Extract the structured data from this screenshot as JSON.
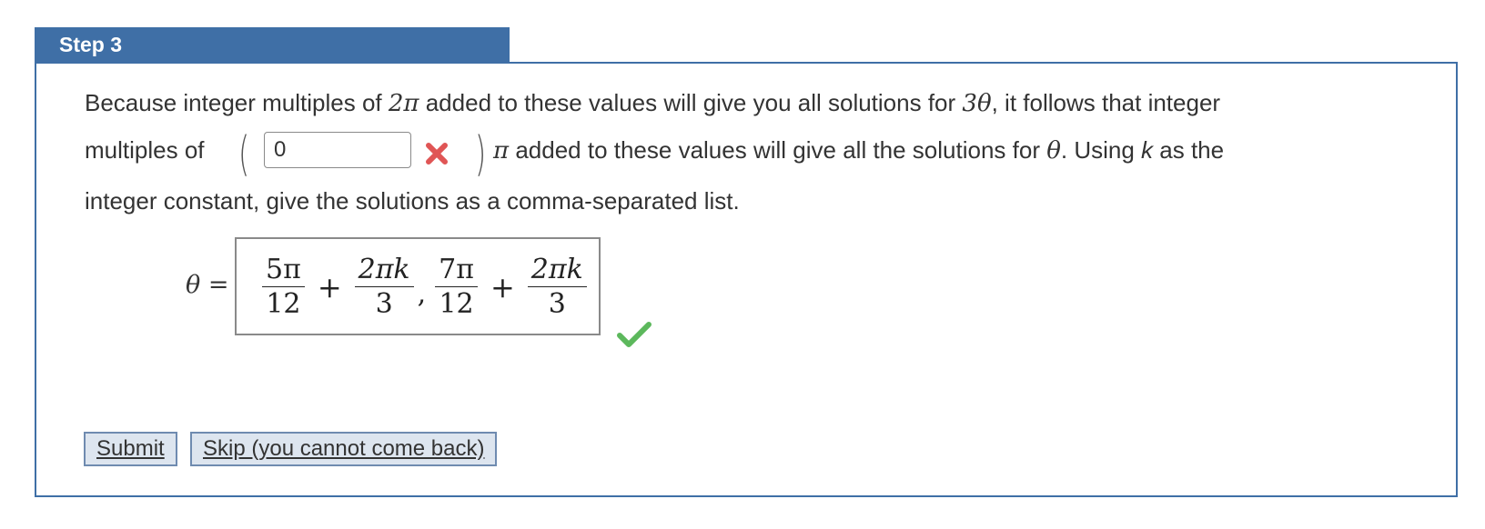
{
  "step": {
    "title": "Step 3"
  },
  "paragraph": {
    "line1_a": "Because integer multiples of ",
    "line1_2pi": "2π",
    "line1_b": " added to these values will give you all solutions for ",
    "line1_3theta": "3θ",
    "line1_c": ", it follows that integer",
    "line2_a": "multiples of",
    "line2_pi": "π",
    "line2_b": " added to these values will give all the solutions for ",
    "line2_theta": "θ",
    "line2_c": ". Using ",
    "line2_k": "k",
    "line2_d": " as the",
    "line3": "integer constant, give the solutions as a comma-separated list."
  },
  "multiple_input": {
    "value": "0",
    "status": "incorrect"
  },
  "solution": {
    "lhs": "θ =",
    "term1_num": "5π",
    "term1_den": "12",
    "plus1": "+",
    "term2_num": "2πk",
    "term2_den": "3",
    "comma": ",",
    "term3_num": "7π",
    "term3_den": "12",
    "plus2": "+",
    "term4_num": "2πk",
    "term4_den": "3",
    "status": "correct"
  },
  "buttons": {
    "submit": "Submit",
    "skip": "Skip (you cannot come back)"
  },
  "colors": {
    "header_bg": "#3f6fa6",
    "incorrect": "#e05555",
    "correct": "#5cb85c",
    "button_bg": "#dde5ef"
  },
  "icons": {
    "incorrect": "x-mark-icon",
    "correct": "checkmark-icon"
  }
}
